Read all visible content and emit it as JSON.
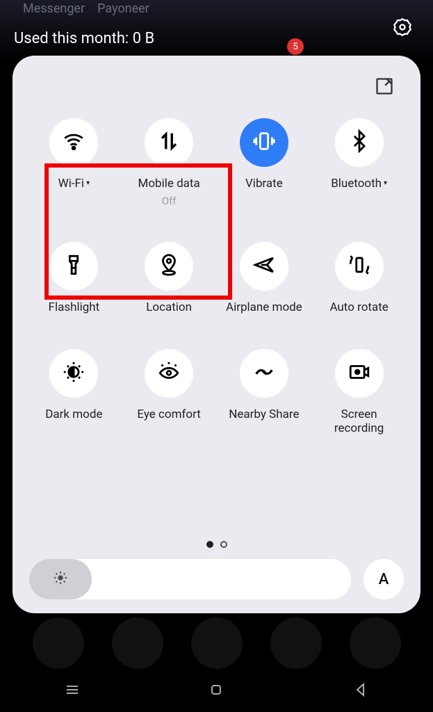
{
  "statusbar": {
    "bg_apps": [
      "Messenger",
      "Payoneer"
    ],
    "usage_text": "Used this month: 0 B",
    "badge_count": "5"
  },
  "panel": {
    "tiles": [
      {
        "label": "Wi-Fi",
        "expandable": true,
        "sub": ""
      },
      {
        "label": "Mobile data",
        "expandable": false,
        "sub": "Off"
      },
      {
        "label": "Vibrate",
        "expandable": false,
        "sub": ""
      },
      {
        "label": "Bluetooth",
        "expandable": true,
        "sub": ""
      },
      {
        "label": "Flashlight",
        "expandable": false,
        "sub": ""
      },
      {
        "label": "Location",
        "expandable": false,
        "sub": ""
      },
      {
        "label": "Airplane mode",
        "expandable": false,
        "sub": ""
      },
      {
        "label": "Auto rotate",
        "expandable": false,
        "sub": ""
      },
      {
        "label": "Dark mode",
        "expandable": false,
        "sub": ""
      },
      {
        "label": "Eye comfort",
        "expandable": false,
        "sub": ""
      },
      {
        "label": "Nearby Share",
        "expandable": false,
        "sub": ""
      },
      {
        "label": "Screen\nrecording",
        "expandable": false,
        "sub": ""
      }
    ],
    "auto_brightness_label": "A",
    "expand_glyph": "▾"
  }
}
